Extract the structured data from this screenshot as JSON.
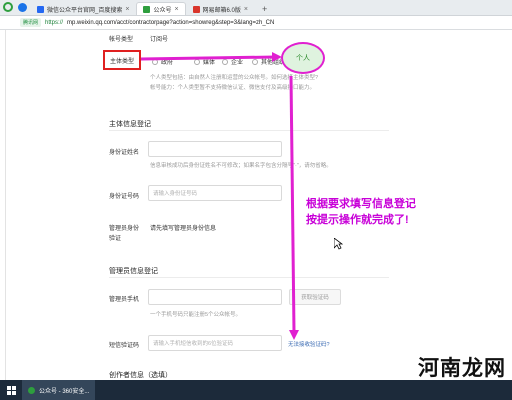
{
  "browser": {
    "tabs": [
      {
        "title": "微信公众平台官网_百度搜索",
        "active": false,
        "icon_color": "#2468f2"
      },
      {
        "title": "公众号",
        "active": true,
        "icon_color": "#2e9e3e"
      },
      {
        "title": "网易邮箱6.0版",
        "active": false,
        "icon_color": "#d9352b"
      }
    ],
    "secure_badge": "腾讯网",
    "url_protocol": "https://",
    "url_rest": "mp.weixin.qq.com/acct/contractorpage?action=showreg&step=3&lang=zh_CN"
  },
  "form": {
    "account_type_label": "帐号类型",
    "account_type_value": "订阅号",
    "subject_type_label": "主体类型",
    "subject_options": [
      "政府",
      "媒体",
      "企业",
      "其他组织"
    ],
    "selected_option": "个人",
    "personal_desc_1": "个人类型包括：由自然人注册和运营的公众帐号。如何选择主体类型?",
    "personal_desc_2": "帐号能力：个人类型暂不支持微信认证、微信支付及高级接口能力。",
    "subject_info_title": "主体信息登记",
    "id_name_label": "身份证姓名",
    "id_name_hint": "信息审核成功后身份证姓名不可修改；如果名字包含分隔号\"·\"，请勿省略。",
    "id_number_label": "身份证号码",
    "id_number_placeholder": "请输入身份证号码",
    "admin_verify_label_1": "管理员身份",
    "admin_verify_label_2": "验证",
    "admin_verify_text": "请先填写管理员身份信息",
    "admin_info_title": "管理员信息登记",
    "admin_phone_label": "管理员手机",
    "get_code_button": "获取验证码",
    "admin_phone_hint": "一个手机号码只能注册5个公众帐号。",
    "sms_code_label": "短信验证码",
    "sms_code_placeholder": "请输入手机短信收到的6位验证码",
    "no_code_link": "无法接收验证码?",
    "creator_info_title": "创作者信息（选填）"
  },
  "annotation": {
    "line1": "根据要求填写信息登记",
    "line2": "按提示操作就完成了!",
    "color": "#c800d8"
  },
  "taskbar": {
    "app_label": "公众号 - 360安全..."
  },
  "watermark": "河南龙网"
}
